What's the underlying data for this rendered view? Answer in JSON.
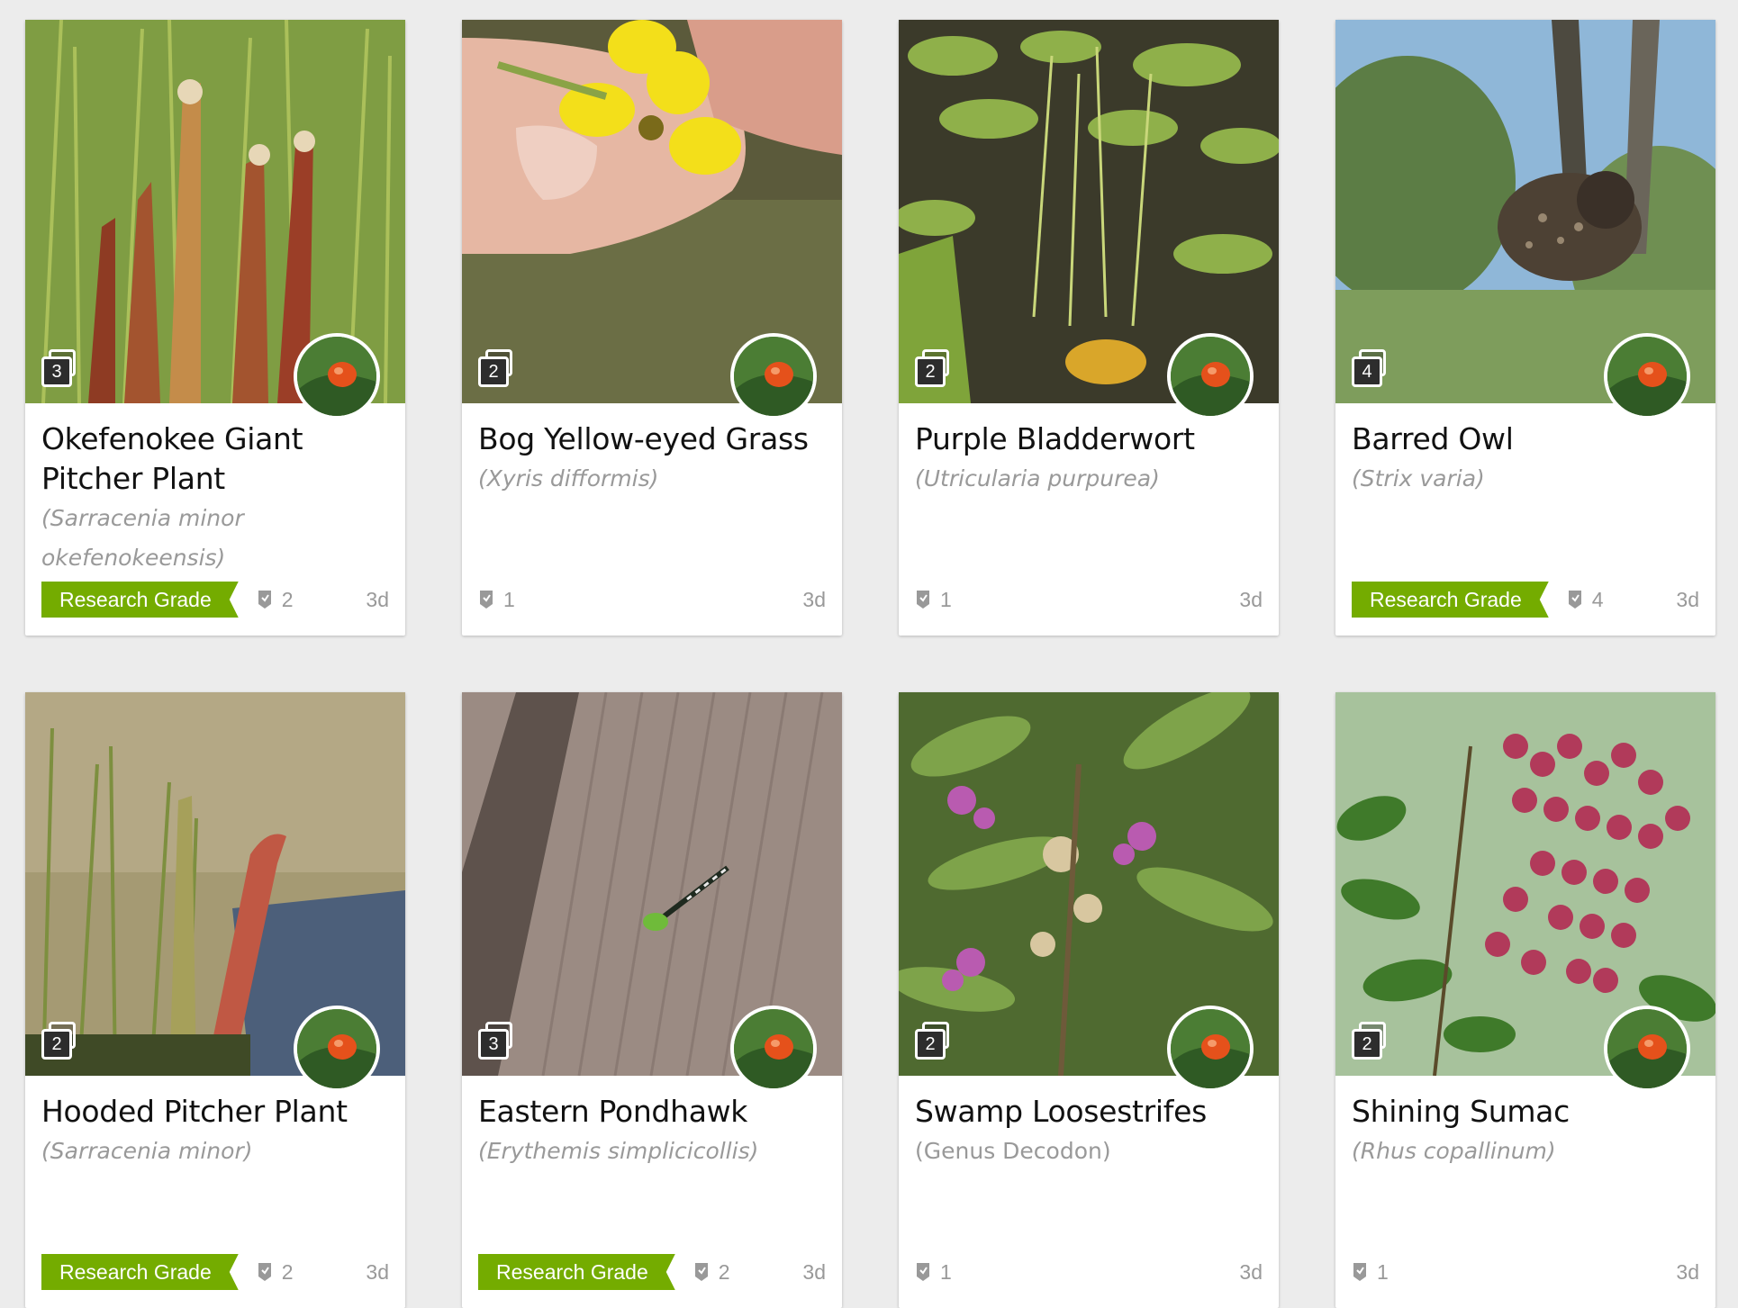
{
  "cards": [
    {
      "title": "Okefenokee Giant Pitcher Plant",
      "scientific": "(Sarracenia minor okefenokeensis)",
      "photos": "3",
      "grade": "Research Grade",
      "ids": "2",
      "age": "3d",
      "image": "pitcher-plant-photo"
    },
    {
      "title": "Bog Yellow-eyed Grass",
      "scientific": "(Xyris difformis)",
      "photos": "2",
      "grade": "",
      "ids": "1",
      "age": "3d",
      "image": "yellow-flower-photo"
    },
    {
      "title": "Purple Bladderwort",
      "scientific": "(Utricularia purpurea)",
      "photos": "2",
      "grade": "",
      "ids": "1",
      "age": "3d",
      "image": "pond-lily-pads-photo"
    },
    {
      "title": "Barred Owl",
      "scientific": "(Strix varia)",
      "photos": "4",
      "grade": "Research Grade",
      "ids": "4",
      "age": "3d",
      "image": "owl-in-tree-photo"
    },
    {
      "title": "Hooded Pitcher Plant",
      "scientific": "(Sarracenia minor)",
      "photos": "2",
      "grade": "Research Grade",
      "ids": "2",
      "age": "3d",
      "image": "hooded-pitcher-photo"
    },
    {
      "title": "Eastern Pondhawk",
      "scientific": "(Erythemis simplicicollis)",
      "photos": "3",
      "grade": "Research Grade",
      "ids": "2",
      "age": "3d",
      "image": "dragonfly-on-wood-photo"
    },
    {
      "title": "Swamp Loosestrifes",
      "scientific": "(Genus Decodon)",
      "photos": "2",
      "grade": "",
      "ids": "1",
      "age": "3d",
      "image": "loosestrife-flowers-photo"
    },
    {
      "title": "Shining Sumac",
      "scientific": "(Rhus copallinum)",
      "photos": "2",
      "grade": "",
      "ids": "1",
      "age": "3d",
      "image": "sumac-berries-photo"
    }
  ]
}
